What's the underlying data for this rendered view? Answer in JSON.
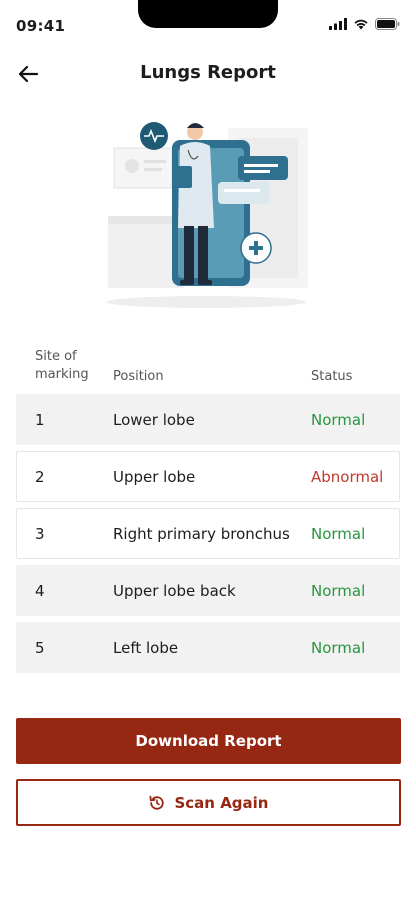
{
  "status_bar": {
    "time": "09:41"
  },
  "header": {
    "title": "Lungs Report",
    "back_icon": "arrow-left-icon"
  },
  "table": {
    "headers": {
      "site": "Site of marking",
      "position": "Position",
      "status": "Status"
    },
    "rows": [
      {
        "site": "1",
        "position": "Lower lobe",
        "status": "Normal"
      },
      {
        "site": "2",
        "position": "Upper lobe",
        "status": "Abnormal"
      },
      {
        "site": "3",
        "position": "Right primary bronchus",
        "status": "Normal"
      },
      {
        "site": "4",
        "position": "Upper lobe back",
        "status": "Normal"
      },
      {
        "site": "5",
        "position": "Left lobe",
        "status": "Normal"
      }
    ]
  },
  "actions": {
    "download_label": "Download Report",
    "scan_again_label": "Scan Again",
    "scan_again_icon": "refresh-icon"
  },
  "colors": {
    "primary": "#962713",
    "normal": "#27963f",
    "abnormal": "#c0392b",
    "illustration_teal": "#2f6f8f"
  }
}
